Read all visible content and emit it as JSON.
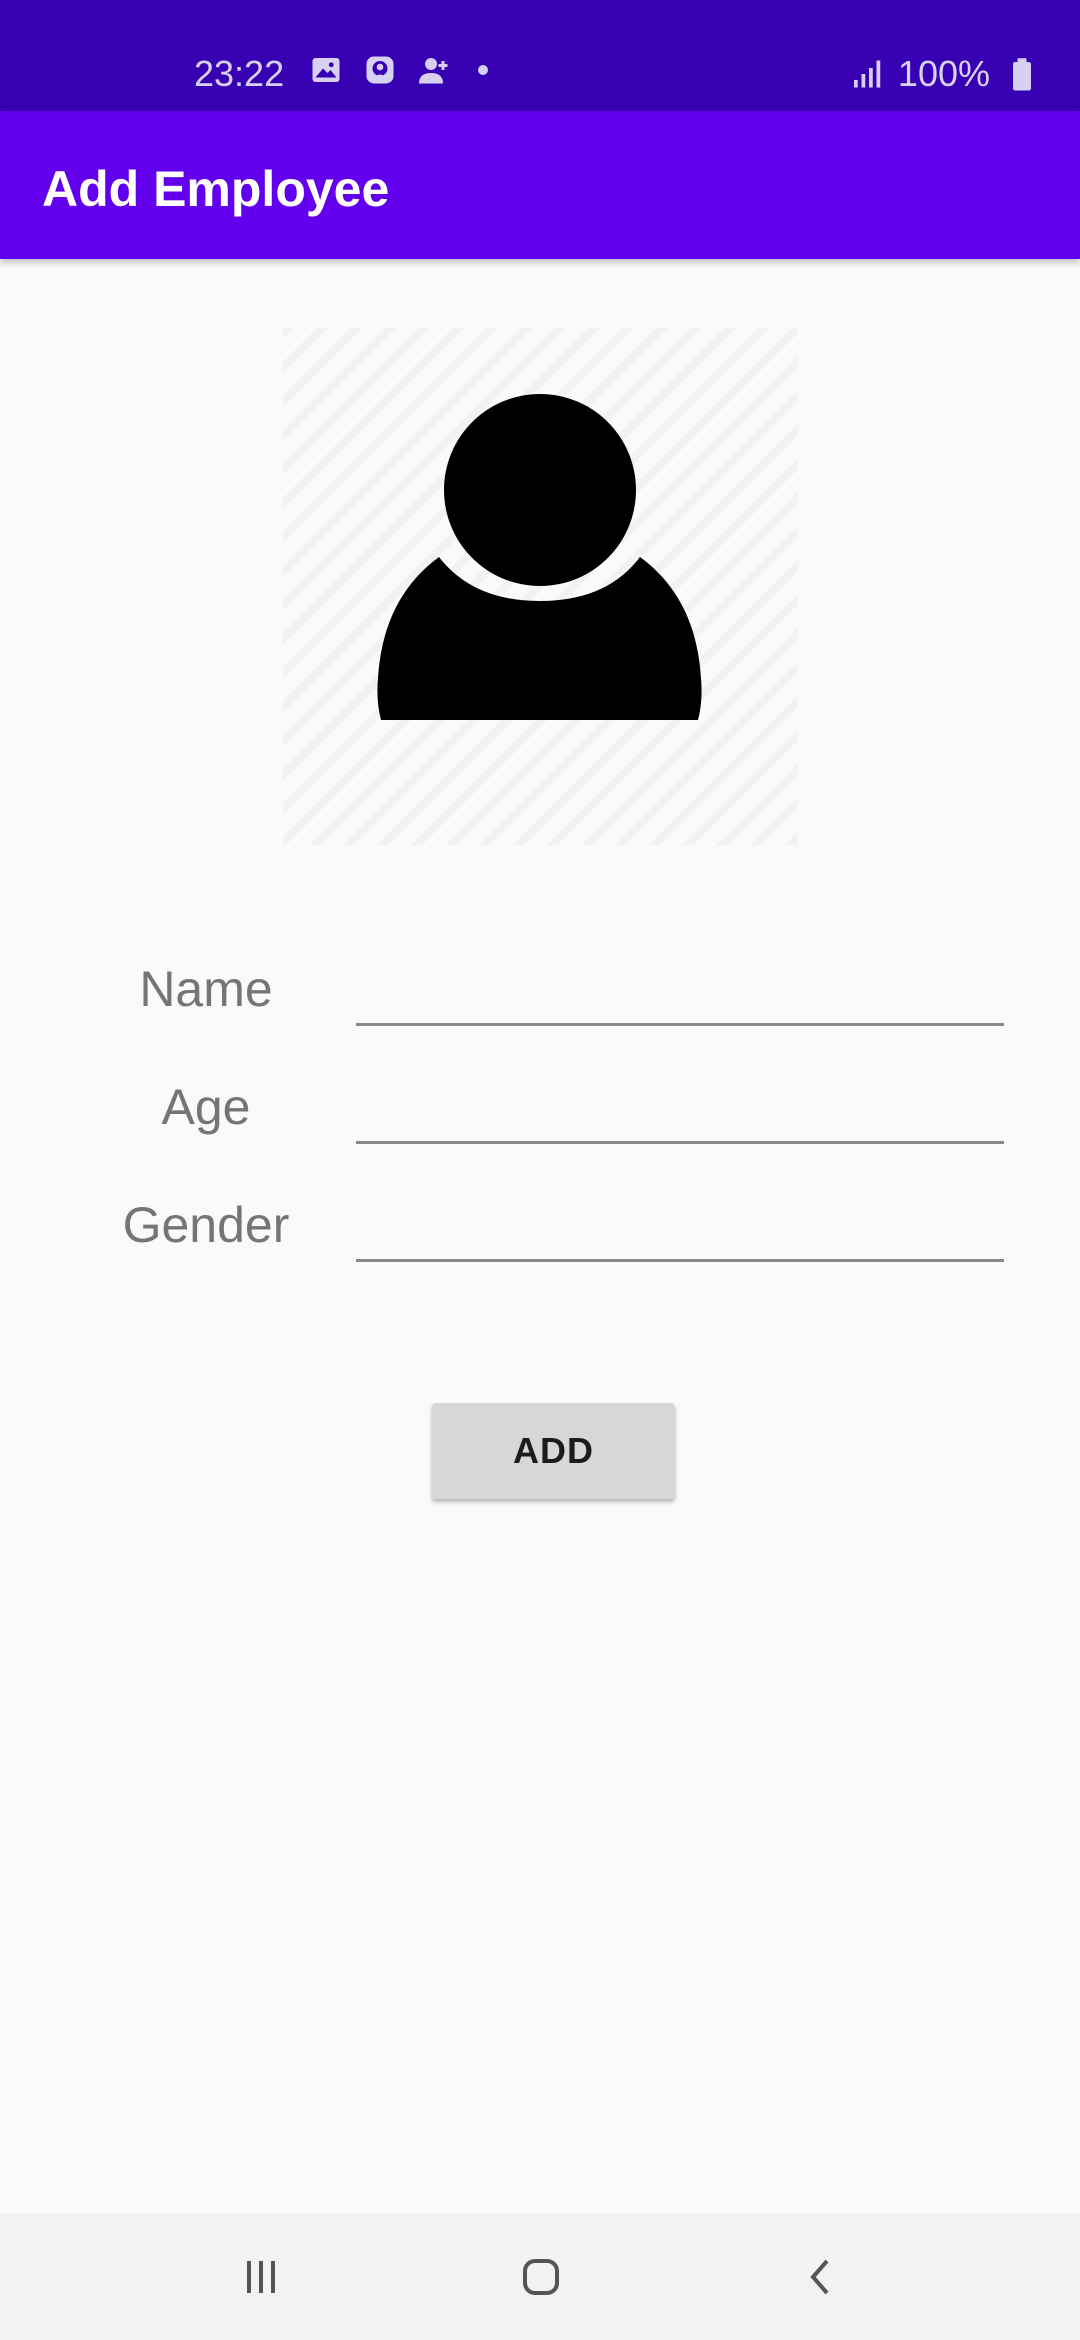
{
  "status_bar": {
    "time": "23:22",
    "battery_text": "100%",
    "icons": [
      "image-icon",
      "messenger-icon",
      "person-add-icon",
      "dot-icon",
      "signal-icon",
      "battery-icon"
    ]
  },
  "app_bar": {
    "title": "Add Employee"
  },
  "avatar": {
    "icon": "person-icon"
  },
  "form": {
    "name_label": "Name",
    "name_value": "",
    "age_label": "Age",
    "age_value": "",
    "gender_label": "Gender",
    "gender_value": ""
  },
  "add_button_label": "ADD",
  "nav_bar": {
    "icons": [
      "recent-apps-icon",
      "home-icon",
      "back-icon"
    ]
  },
  "colors": {
    "status_bar": "#3700b3",
    "app_bar": "#6200ee",
    "background": "#fafafa",
    "button": "#d6d7d7",
    "label_text": "#757575"
  }
}
